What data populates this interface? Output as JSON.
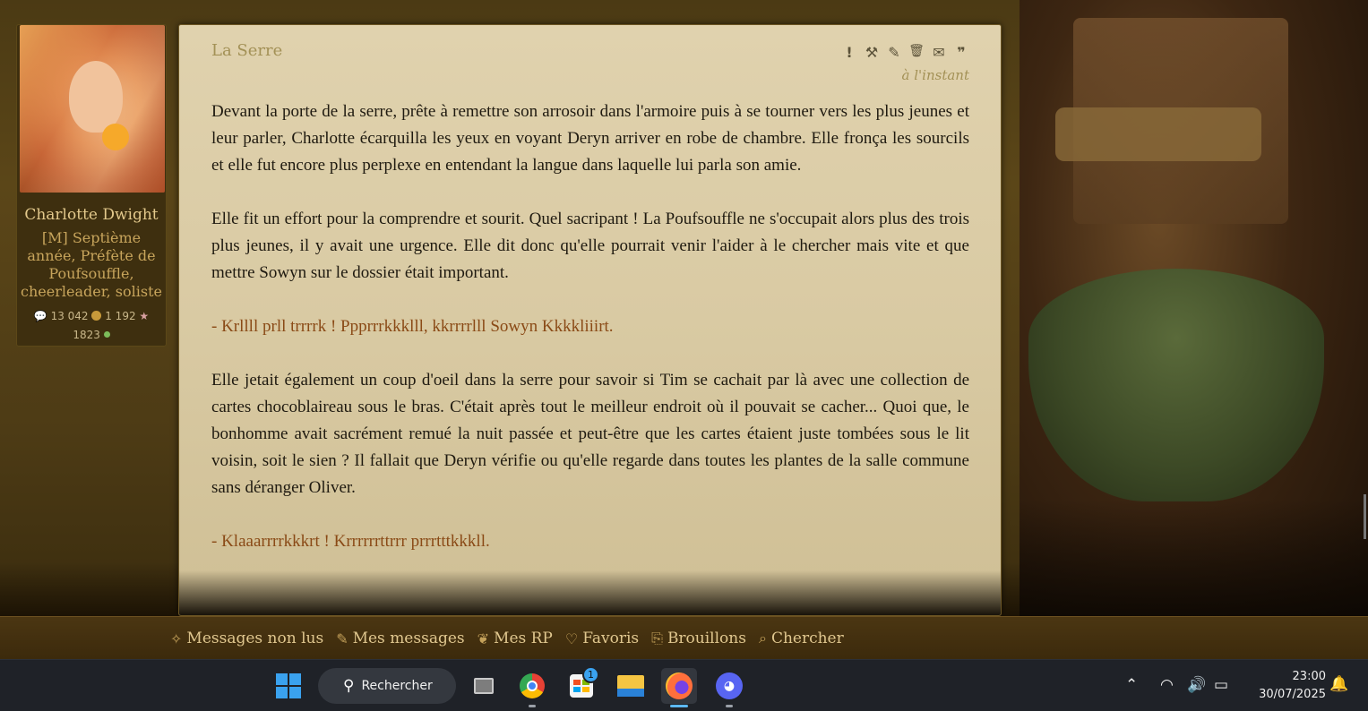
{
  "profile": {
    "name": "Charlotte Dwight",
    "title": "[M] Septième année, Préfète de Poufsouffle, cheerleader, soliste",
    "messages": "13 042",
    "coins": "1 192",
    "points": "1823"
  },
  "post": {
    "title": "La Serre",
    "time": "à l'instant",
    "tools": [
      {
        "icon": "exclamation-icon",
        "glyph": "!"
      },
      {
        "icon": "hammer-icon",
        "glyph": "⚒"
      },
      {
        "icon": "pencil-icon",
        "glyph": "✎"
      },
      {
        "icon": "trash-icon",
        "glyph": "🗑"
      },
      {
        "icon": "envelope-icon",
        "glyph": "✉"
      },
      {
        "icon": "quote-icon",
        "glyph": "❞"
      }
    ],
    "paragraphs": [
      "Devant la porte de la serre, prête à remettre son arrosoir dans l'armoire puis à se tourner vers les plus jeunes et leur parler, Charlotte écarquilla les yeux en voyant Deryn arriver en robe de chambre. Elle fronça les sourcils et elle fut encore plus perplexe en entendant la langue dans laquelle lui parla son amie.",
      "Elle fit un effort pour la comprendre et sourit. Quel sacripant ! La Poufsouffle ne s'occupait alors plus des trois plus jeunes, il y avait une urgence. Elle dit donc qu'elle pourrait venir l'aider à le chercher mais vite et que mettre Sowyn sur le dossier était important.",
      "- Krllll prll trrrrk ! Ppprrrkkklll, kkrrrrlll Sowyn Kkkkliiirt.",
      "Elle jetait également un coup d'oeil dans la serre pour savoir si Tim se cachait par là avec une collection de cartes chocoblaireau sous le bras. C'était après tout le meilleur endroit où il pouvait se cacher... Quoi que, le bonhomme avait sacrément remué la nuit passée et peut-être que les cartes étaient juste tombées sous le lit voisin, soit le sien ? Il fallait que Deryn vérifie ou qu'elle regarde dans toutes les plantes de la salle commune sans déranger Oliver.",
      "- Klaaarrrrkkkrt ! Krrrrrrttrrr prrrtttkkkll."
    ]
  },
  "forum_nav": [
    {
      "label": "Messages non lus",
      "icon": "sparkle-icon",
      "glyph": "✧"
    },
    {
      "label": "Mes messages",
      "icon": "pen-icon",
      "glyph": "✎"
    },
    {
      "label": "Mes RP",
      "icon": "feather-icon",
      "glyph": "❦"
    },
    {
      "label": "Favoris",
      "icon": "heart-icon",
      "glyph": "♡"
    },
    {
      "label": "Brouillons",
      "icon": "drafts-icon",
      "glyph": "⎘"
    },
    {
      "label": "Chercher",
      "icon": "search-icon",
      "glyph": "⌕"
    }
  ],
  "taskbar": {
    "search_label": "Rechercher",
    "store_badge": "1",
    "time": "23:00",
    "date": "30/07/2025"
  }
}
